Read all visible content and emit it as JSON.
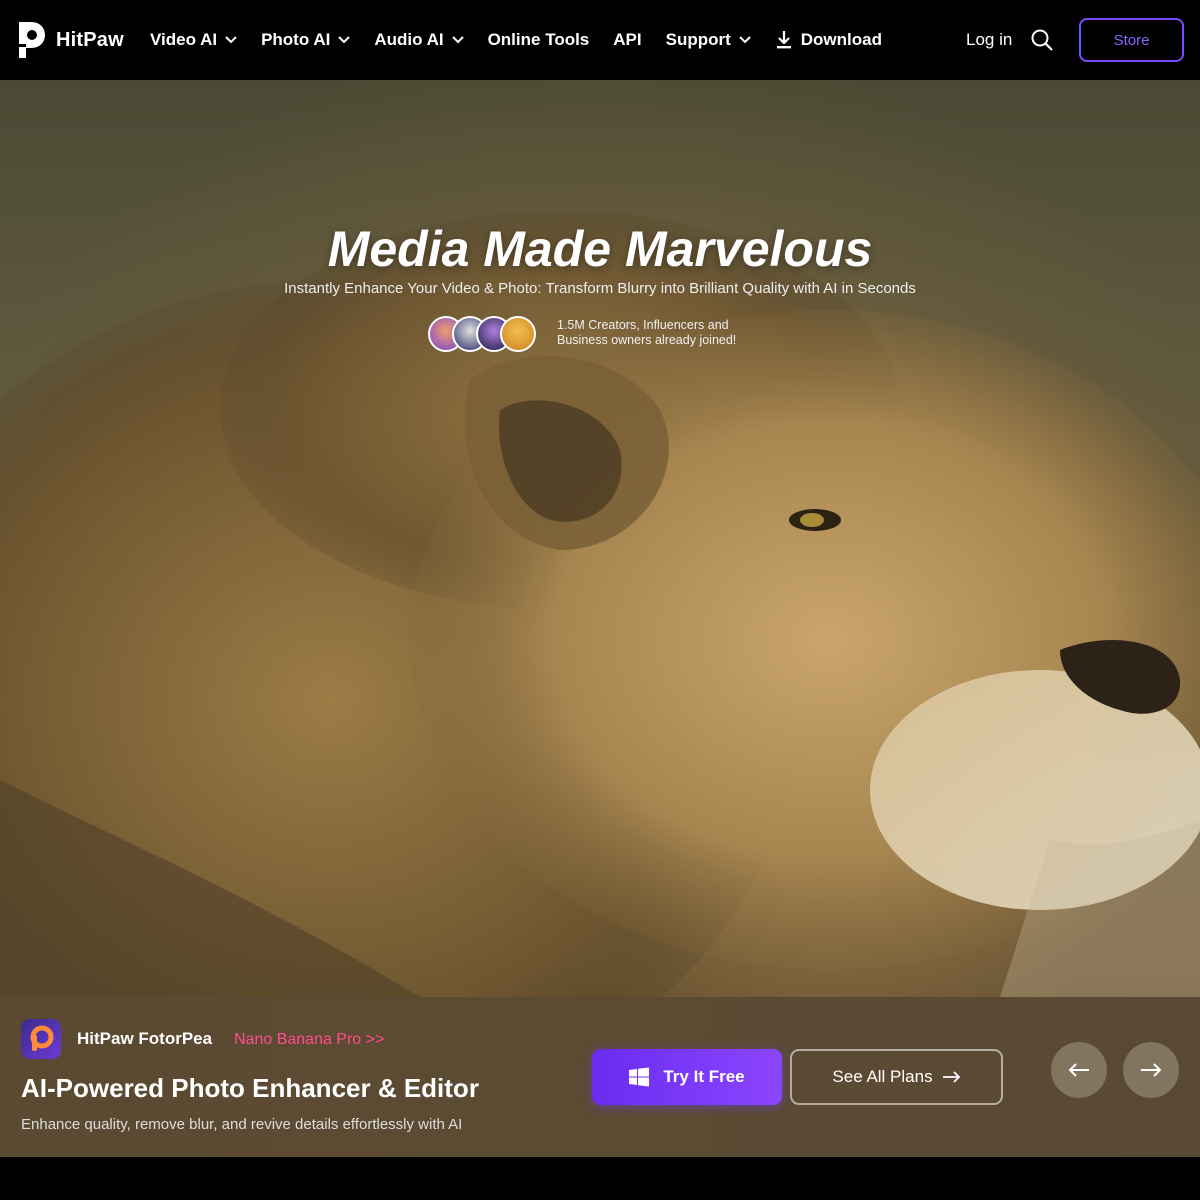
{
  "brand": {
    "name": "HitPaw"
  },
  "nav": {
    "items": [
      {
        "label": "Video AI",
        "dropdown": true
      },
      {
        "label": "Photo AI",
        "dropdown": true
      },
      {
        "label": "Audio AI",
        "dropdown": true
      },
      {
        "label": "Online Tools",
        "dropdown": false
      },
      {
        "label": "API",
        "dropdown": false
      },
      {
        "label": "Support",
        "dropdown": true
      }
    ],
    "download_label": "Download",
    "login_label": "Log in",
    "store_label": "Store"
  },
  "hero": {
    "title": "Media Made Marvelous",
    "subtitle": "Instantly Enhance Your Video & Photo: Transform Blurry into Brilliant Quality with AI in Seconds",
    "joined_line1": "1.5M Creators, Influencers and",
    "joined_line2": "Business owners already joined!"
  },
  "product": {
    "app_name": "HitPaw FotorPea",
    "promo_label": "Nano Banana Pro >>",
    "title": "AI-Powered Photo Enhancer & Editor",
    "description": "Enhance quality, remove blur, and revive details effortlessly with AI",
    "try_label": "Try It Free",
    "plans_label": "See All Plans"
  },
  "colors": {
    "accent": "#7b4dff",
    "promo": "#ff4d8d",
    "background": "#000000"
  }
}
